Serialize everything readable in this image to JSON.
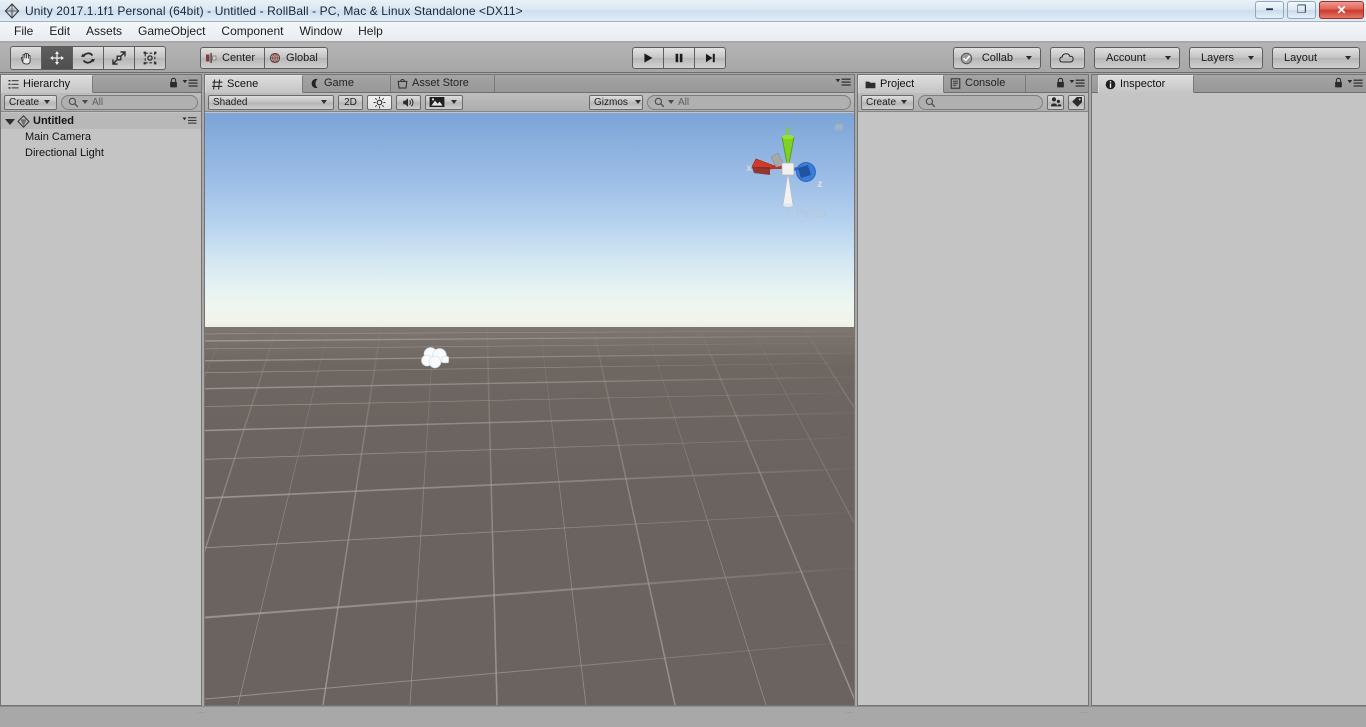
{
  "window": {
    "title": "Unity 2017.1.1f1 Personal (64bit) - Untitled - RollBall - PC, Mac & Linux Standalone <DX11>",
    "app_icon": "unity-logo-icon",
    "controls": {
      "minimize": "–",
      "restore": "❐",
      "close": "✕"
    }
  },
  "menubar": {
    "items": [
      {
        "label": "File"
      },
      {
        "label": "Edit"
      },
      {
        "label": "Assets"
      },
      {
        "label": "GameObject"
      },
      {
        "label": "Component"
      },
      {
        "label": "Window"
      },
      {
        "label": "Help"
      }
    ]
  },
  "toolbar": {
    "transform_tools": [
      {
        "name": "hand-tool",
        "icon": "hand-icon",
        "active": false
      },
      {
        "name": "move-tool",
        "icon": "move-arrows-icon",
        "active": true
      },
      {
        "name": "rotate-tool",
        "icon": "rotate-icon",
        "active": false
      },
      {
        "name": "scale-tool",
        "icon": "scale-icon",
        "active": false
      },
      {
        "name": "rect-tool",
        "icon": "rect-transform-icon",
        "active": false
      }
    ],
    "pivot_mode": {
      "label": "Center",
      "icon": "pivot-center-icon"
    },
    "pivot_rotation": {
      "label": "Global",
      "icon": "globe-icon"
    },
    "playback": [
      {
        "name": "play-button",
        "icon": "play-triangle-icon"
      },
      {
        "name": "pause-button",
        "icon": "pause-bars-icon"
      },
      {
        "name": "step-button",
        "icon": "step-forward-icon"
      }
    ],
    "collab": {
      "label": "Collab",
      "icon": "collab-check-icon",
      "caret": true
    },
    "cloud": {
      "label": "",
      "icon": "cloud-icon"
    },
    "account": {
      "label": "Account",
      "caret": true
    },
    "layers": {
      "label": "Layers",
      "caret": true
    },
    "layout": {
      "label": "Layout",
      "caret": true
    }
  },
  "hierarchy": {
    "tab": {
      "label": "Hierarchy",
      "icon": "hierarchy-list-icon"
    },
    "create_button": {
      "label": "Create",
      "caret": true
    },
    "search": {
      "value": "",
      "placeholder": "All",
      "icon": "search-icon"
    },
    "lock_icon": "lock-icon",
    "menu_icon": "panel-menu-icon",
    "scene": {
      "label": "Untitled",
      "icon": "unity-scene-icon",
      "expanded": true
    },
    "objects": [
      {
        "label": "Main Camera"
      },
      {
        "label": "Directional Light"
      }
    ]
  },
  "scene_panel": {
    "tabs": [
      {
        "label": "Scene",
        "icon": "scene-grid-icon",
        "active": true
      },
      {
        "label": "Game",
        "icon": "game-pad-icon",
        "active": false
      },
      {
        "label": "Asset Store",
        "icon": "asset-store-icon",
        "active": false
      }
    ],
    "menu_icon": "panel-menu-icon",
    "draw_mode": {
      "label": "Shaded",
      "caret": true
    },
    "mode_2d": {
      "label": "2D"
    },
    "lighting_toggle": {
      "icon": "sun-light-icon",
      "active": true
    },
    "audio_toggle": {
      "icon": "speaker-audio-icon"
    },
    "effects_toggle": {
      "icon": "image-effects-icon",
      "caret": true
    },
    "gizmos": {
      "label": "Gizmos",
      "caret": true
    },
    "search": {
      "value": "",
      "placeholder": "All",
      "icon": "search-icon"
    },
    "viewport": {
      "axis_gizmo": {
        "x_label": "x",
        "y_label": "y",
        "z_label": "z",
        "x_color": "#d13b2a",
        "y_color": "#7ed321",
        "z_color": "#3b7ddd"
      },
      "projection_label": "Persp",
      "lock_icon": "lock-icon",
      "sky_top_color": "#7ca4d8",
      "sky_horizon_color": "#eef6ef",
      "ground_color": "#6b6360",
      "grid_color": "#8b8580",
      "cloud": "cloud-shape"
    }
  },
  "project_panel": {
    "tabs": [
      {
        "label": "Project",
        "icon": "folder-icon",
        "active": true
      },
      {
        "label": "Console",
        "icon": "console-icon",
        "active": false
      }
    ],
    "lock_icon": "lock-icon",
    "menu_icon": "panel-menu-icon",
    "create_button": {
      "label": "Create",
      "caret": true
    },
    "search": {
      "value": "",
      "placeholder": "",
      "icon": "search-icon"
    },
    "filter_type_icon": "filter-by-type-icon",
    "filter_label_icon": "filter-by-label-icon"
  },
  "inspector_panel": {
    "tab": {
      "label": "Inspector",
      "icon": "info-circle-icon",
      "active": true
    },
    "lock_icon": "lock-icon",
    "menu_icon": "panel-menu-icon"
  }
}
